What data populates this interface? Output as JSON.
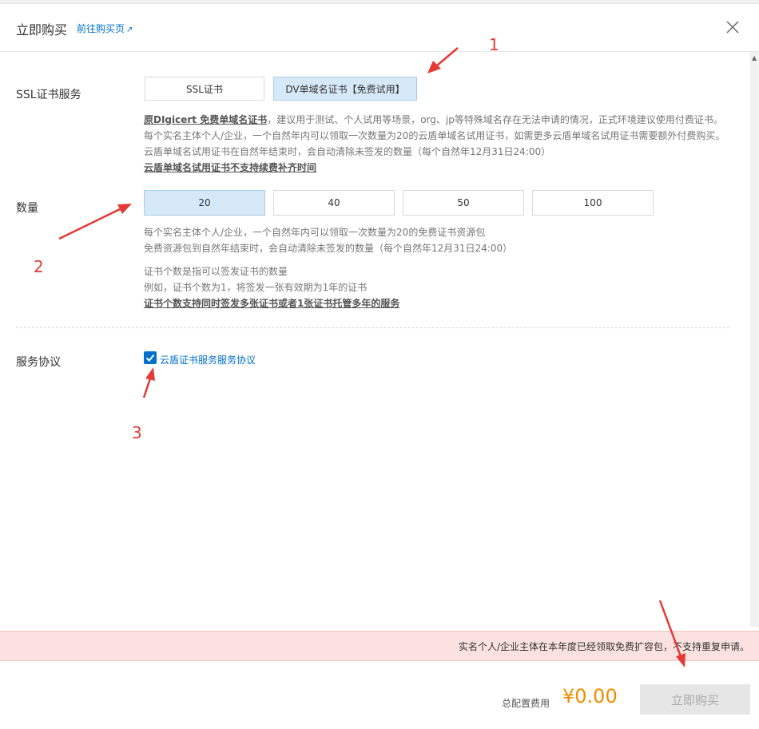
{
  "header": {
    "title": "立即购买",
    "link": "前往购买页"
  },
  "ssl": {
    "label": "SSL证书服务",
    "options": [
      "SSL证书",
      "DV单域名证书【免费试用】"
    ],
    "selected": 1,
    "desc": {
      "line1_bold": "原DIgicert 免费单域名证书",
      "line1_rest": "，建议用于测试、个人试用等场景，org、jp等特殊域名存在无法申请的情况，正式环境建议使用付费证书。",
      "line2": "每个实名主体个人/企业，一个自然年内可以领取一次数量为20的云盾单域名试用证书，如需更多云盾单域名试用证书需要额外付费购买。",
      "line3": "云盾单域名试用证书在自然年结束时，会自动清除未签发的数量（每个自然年12月31日24:00）",
      "line4": "云盾单域名试用证书不支持续费补齐时间"
    }
  },
  "quantity": {
    "label": "数量",
    "options": [
      "20",
      "40",
      "50",
      "100"
    ],
    "selected": 0,
    "desc": {
      "line1": "每个实名主体个人/企业，一个自然年内可以领取一次数量为20的免费证书资源包",
      "line2": "免费资源包到自然年结束时，会自动清除未签发的数量（每个自然年12月31日24:00）",
      "line3": "证书个数是指可以签发证书的数量",
      "line4": "例如，证书个数为1，将签发一张有效期为1年的证书",
      "line5": "证书个数支持同时签发多张证书或者1张证书托管多年的服务"
    }
  },
  "agreement": {
    "label": "服务协议",
    "checked": true,
    "link": "云盾证书服务服务协议"
  },
  "warning": "实名个人/企业主体在本年度已经领取免费扩容包，不支持重复申请。",
  "footer": {
    "fee_label": "总配置费用",
    "price": "¥0.00",
    "buy_label": "立即购买"
  },
  "annotations": [
    "1",
    "2",
    "3"
  ],
  "colors": {
    "accent": "#0070cc",
    "selected_bg": "#d6e9f8",
    "price": "#f08c00",
    "warning_bg": "#fbe2e0",
    "annotation": "#e53935"
  }
}
